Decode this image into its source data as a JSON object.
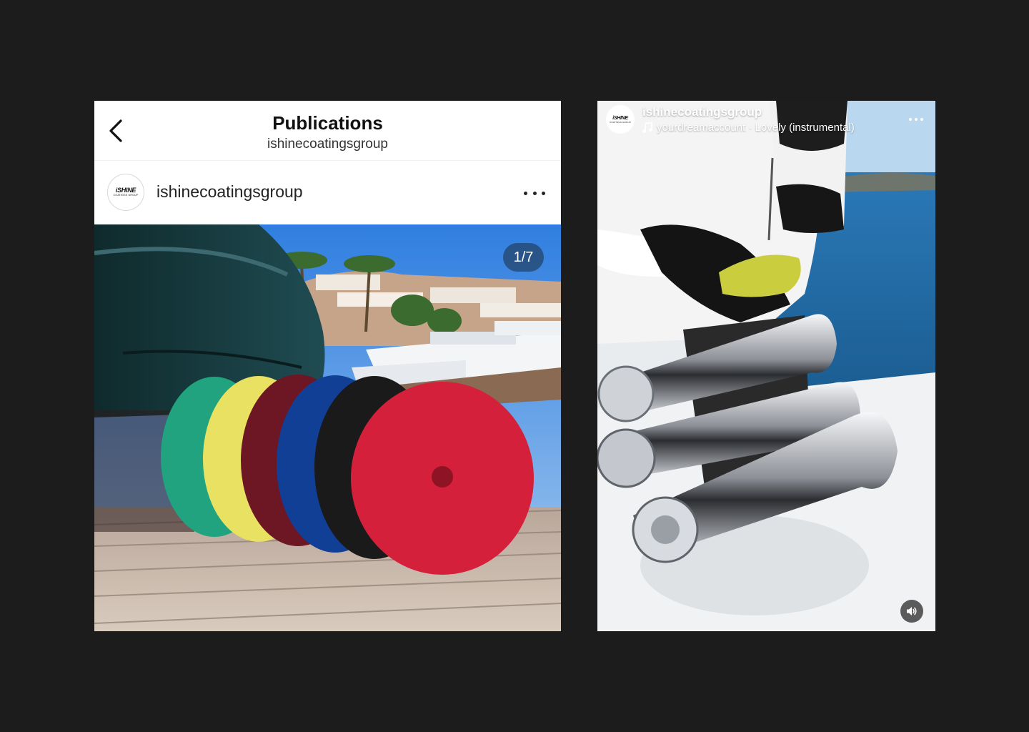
{
  "feed_post": {
    "header": {
      "title": "Publications",
      "subtitle": "ishinecoatingsgroup",
      "back_icon": "chevron-left-icon"
    },
    "author": {
      "username": "ishinecoatingsgroup",
      "avatar_logo": "iSHINE",
      "avatar_logo_sub": "COATINGS GROUP",
      "more_icon": "more-horizontal-icon"
    },
    "media": {
      "counter": "1/7",
      "pad_colors": [
        "#20a37e",
        "#e9e161",
        "#6d1624",
        "#123f96",
        "#1a1a1a",
        "#d5203b"
      ]
    }
  },
  "reel": {
    "author": {
      "username": "ishinecoatingsgroup",
      "avatar_logo": "iSHINE",
      "avatar_logo_sub": "COATINGS GROUP"
    },
    "audio": {
      "icon": "music-note-icon",
      "text": "yourdreamaccount · Lovely (instrumental)"
    },
    "more_icon": "more-horizontal-icon",
    "volume_icon": "volume-icon"
  },
  "colors": {
    "page_background": "#1c1c1c",
    "panel_background": "#ffffff",
    "badge_background": "#1e3750"
  }
}
